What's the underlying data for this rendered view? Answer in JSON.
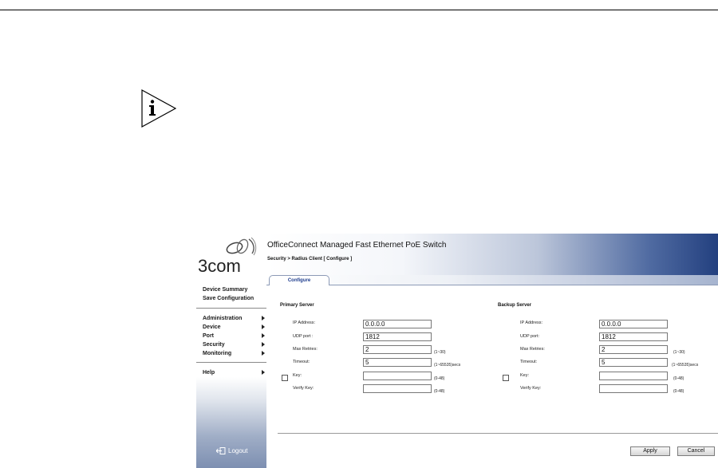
{
  "app": {
    "product_title": "OfficeConnect Managed Fast Ethernet PoE Switch",
    "breadcrumb": "Security > Radius Client [ Configure ]",
    "brand": "3com"
  },
  "sidebar": {
    "top_items": [
      "Device Summary",
      "Save Configuration"
    ],
    "menu_items": [
      "Administration",
      "Device",
      "Port",
      "Security",
      "Monitoring"
    ],
    "help": "Help",
    "logout": "Logout"
  },
  "tabs": [
    {
      "label": "Configure"
    }
  ],
  "primary": {
    "title": "Primary Server",
    "ip_label": "IP Address:",
    "ip_value": "0.0.0.0",
    "udp_label": "UDP port :",
    "udp_value": "1812",
    "retries_label": "Max Retries:",
    "retries_value": "2",
    "retries_hint": "(1~30)",
    "timeout_label": "Timeout:",
    "timeout_value": "5",
    "timeout_hint": "(1~65535)secs",
    "key_label": "Key:",
    "key_value": "",
    "key_hint": "(0-48)",
    "verify_label": "Verify Key:",
    "verify_value": "",
    "verify_hint": "(0-48)"
  },
  "backup": {
    "title": "Backup Server",
    "ip_label": "IP Address:",
    "ip_value": "0.0.0.0",
    "udp_label": "UDP port:",
    "udp_value": "1812",
    "retries_label": "Max Retries:",
    "retries_value": "2",
    "retries_hint": "(1~30)",
    "timeout_label": "Timeout:",
    "timeout_value": "5",
    "timeout_hint": "(1~65535)secs",
    "key_label": "Key:",
    "key_value": "",
    "key_hint": "(0-48)",
    "verify_label": "Verify Key:",
    "verify_value": "",
    "verify_hint": "(0-48)"
  },
  "buttons": {
    "apply": "Apply",
    "cancel": "Cancel"
  },
  "icons": {
    "note": "info-note-icon",
    "logout": "logout-icon",
    "menu_arrow": "triangle-right-icon"
  }
}
